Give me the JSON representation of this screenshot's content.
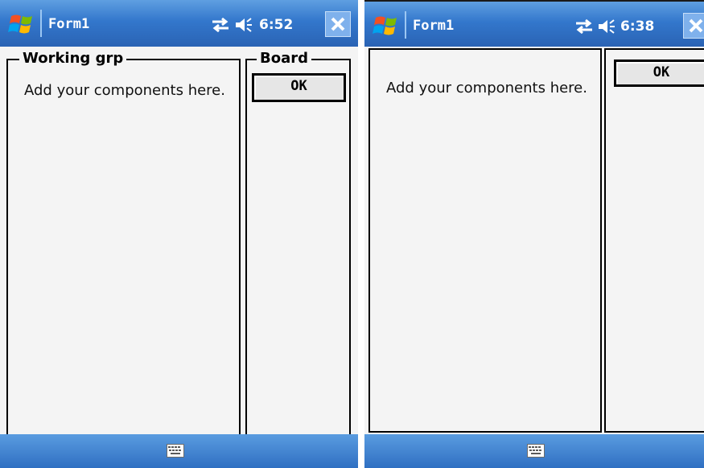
{
  "screens": [
    {
      "title": "Form1",
      "time": "6:52",
      "groups": [
        {
          "label": "Working grp",
          "placeholder": "Add your components here."
        },
        {
          "label": "Board"
        }
      ],
      "ok_label": "OK"
    },
    {
      "title": "Form1",
      "time": "6:38",
      "groups": [
        {
          "label": "",
          "placeholder": "Add your components here."
        },
        {
          "label": ""
        }
      ],
      "ok_label": "OK"
    }
  ],
  "icons": {
    "start": "windows-flag-icon",
    "connectivity": "sync-arrows-icon",
    "volume": "speaker-icon",
    "close": "close-icon",
    "input": "keyboard-icon"
  },
  "colors": {
    "titlebar": "#3377cc",
    "content": "#f4f4f4",
    "button": "#e6e6e6"
  }
}
